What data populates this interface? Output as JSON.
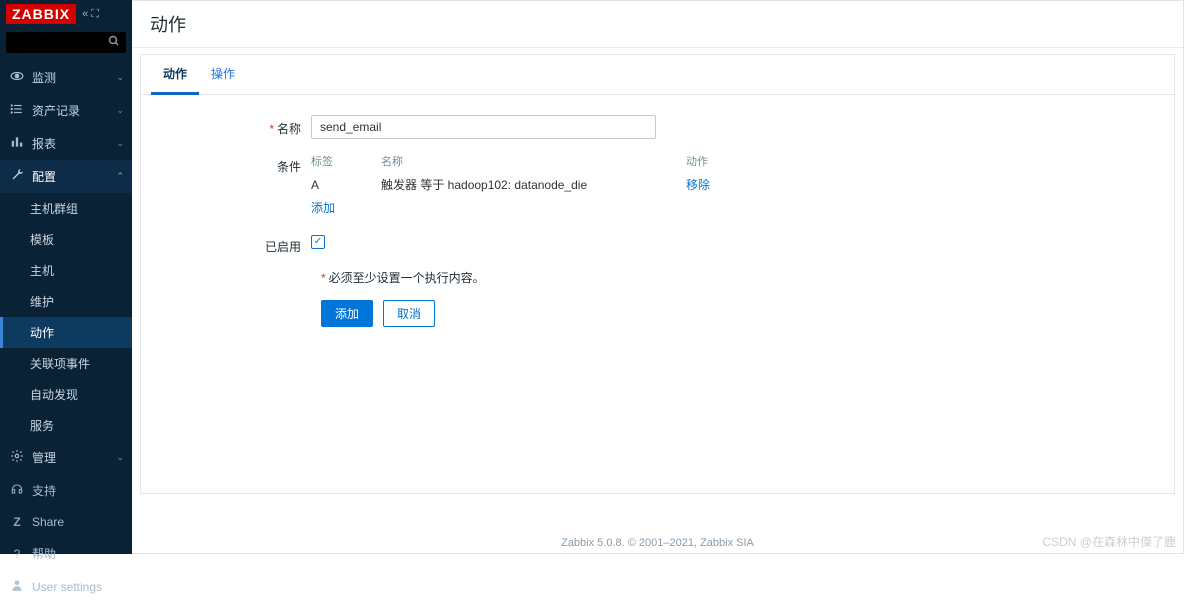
{
  "brand": "ZABBIX",
  "sidebar": {
    "search_placeholder": "",
    "items": [
      {
        "icon": "👁",
        "label": "监测",
        "expandable": true
      },
      {
        "icon": "≡",
        "label": "资产记录",
        "expandable": true
      },
      {
        "icon": "📊",
        "label": "报表",
        "expandable": true
      },
      {
        "icon": "🔧",
        "label": "配置",
        "expandable": true,
        "active": true,
        "children": [
          {
            "label": "主机群组"
          },
          {
            "label": "模板"
          },
          {
            "label": "主机"
          },
          {
            "label": "维护"
          },
          {
            "label": "动作",
            "active": true
          },
          {
            "label": "关联项事件"
          },
          {
            "label": "自动发现"
          },
          {
            "label": "服务"
          }
        ]
      },
      {
        "icon": "⚙",
        "label": "管理",
        "expandable": true
      }
    ],
    "bottom": [
      {
        "icon": "🎧",
        "label": "支持"
      },
      {
        "icon": "Z",
        "label": "Share"
      },
      {
        "icon": "?",
        "label": "帮助"
      },
      {
        "icon": "👤",
        "label": "User settings"
      }
    ]
  },
  "page": {
    "title": "动作",
    "tabs": [
      {
        "label": "动作",
        "active": true
      },
      {
        "label": "操作"
      }
    ],
    "form": {
      "name_label": "名称",
      "name_value": "send_email",
      "cond_label": "条件",
      "cond_headers": {
        "tag": "标签",
        "name": "名称",
        "action": "动作"
      },
      "cond_rows": [
        {
          "tag": "A",
          "name": "触发器 等于 hadoop102: datanode_die",
          "action": "移除"
        }
      ],
      "cond_add": "添加",
      "enabled_label": "已启用",
      "enabled": true,
      "warn": "必须至少设置一个执行内容。",
      "submit": "添加",
      "cancel": "取消"
    },
    "footer": "Zabbix 5.0.8. © 2001–2021, Zabbix SIA"
  },
  "watermark": "CSDN @在森林中傑了鹿"
}
